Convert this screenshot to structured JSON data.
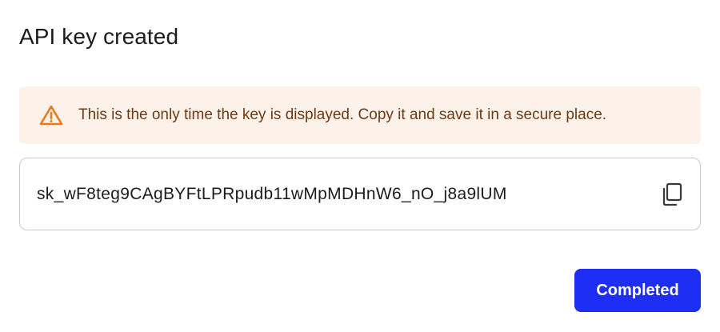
{
  "dialog": {
    "title": "API key created",
    "warning": {
      "icon": "warning-triangle-icon",
      "text": "This is the only time the key is displayed. Copy it and save it in a secure place.",
      "accent_color": "#ea7a1e",
      "background_color": "#fdf2ea"
    },
    "key_field": {
      "value": "sk_wF8teg9CAgBYFtLPRpudb11wMpMDHnW6_nO_j8a9lUM",
      "copy_icon": "copy-icon"
    },
    "actions": {
      "completed_label": "Completed",
      "primary_color": "#1f2ef5"
    }
  }
}
